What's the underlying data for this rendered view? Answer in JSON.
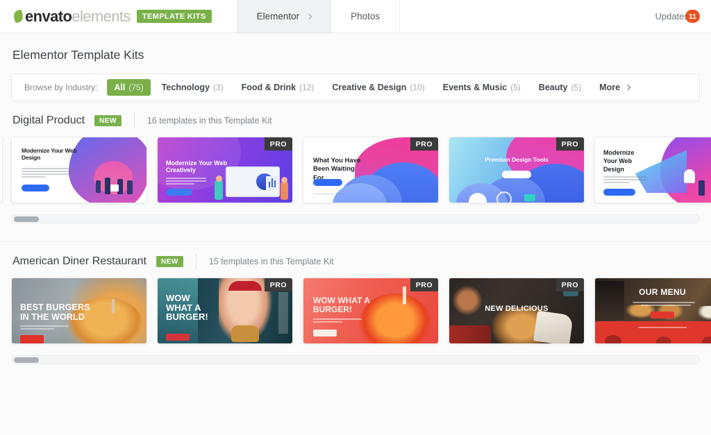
{
  "header": {
    "brand": {
      "envato": "envato",
      "elements": "elements",
      "kits_badge": "TEMPLATE KITS"
    },
    "tabs": [
      {
        "label": "Elementor",
        "active": true,
        "has_chevron": true,
        "icon": "chevron-right-icon"
      },
      {
        "label": "Photos",
        "active": false,
        "has_chevron": false
      }
    ],
    "updates": {
      "label": "Updates",
      "count": "11",
      "badge_color": "#e5541f"
    }
  },
  "page": {
    "title": "Elementor Template Kits"
  },
  "filter": {
    "intro": "Browse by Industry:",
    "chips": [
      {
        "label": "All",
        "count": "(75)",
        "active": true
      },
      {
        "label": "Technology",
        "count": "(3)",
        "active": false
      },
      {
        "label": "Food & Drink",
        "count": "(12)",
        "active": false
      },
      {
        "label": "Creative & Design",
        "count": "(10)",
        "active": false
      },
      {
        "label": "Events & Music",
        "count": "(5)",
        "active": false
      },
      {
        "label": "Beauty",
        "count": "(5)",
        "active": false
      }
    ],
    "more_label": "More"
  },
  "sections": [
    {
      "title": "Digital Product",
      "badge": "NEW",
      "count_text": "16 templates in this Template Kit",
      "scroll_thumb_pct": 7,
      "cards": [
        {
          "heading": "Modernize Your Web Design",
          "pro": false,
          "style": "light-illus"
        },
        {
          "heading": "Modernize Your Web Creatively",
          "pro": true,
          "pro_label": "PRO",
          "style": "purple-gradient"
        },
        {
          "heading": "What You Have Been Waiting For.",
          "pro": true,
          "pro_label": "PRO",
          "style": "pink-blue-waves"
        },
        {
          "heading": "Premium Design Tools",
          "pro": true,
          "pro_label": "PRO",
          "style": "blue-cyan-blob"
        },
        {
          "heading": "Modernize Your Web Design",
          "pro": false,
          "style": "light-illus-2"
        }
      ]
    },
    {
      "title": "American Diner Restaurant",
      "badge": "NEW",
      "count_text": "15 templates in this Template Kit",
      "scroll_thumb_pct": 7,
      "cards": [
        {
          "heading": "BEST BURGERS IN THE WORLD",
          "pro": false,
          "style": "photo-burger-grey"
        },
        {
          "heading": "WOW WHAT A BURGER!",
          "pro": true,
          "pro_label": "PRO",
          "style": "photo-woman"
        },
        {
          "heading": "WOW WHAT A BURGER!",
          "pro": true,
          "pro_label": "PRO",
          "style": "photo-red-burger"
        },
        {
          "heading": "NEW DELICIOUS",
          "pro": true,
          "pro_label": "PRO",
          "style": "photo-hand-burger"
        },
        {
          "heading": "OUR MENU",
          "pro": false,
          "style": "photo-menu-red"
        }
      ]
    }
  ]
}
